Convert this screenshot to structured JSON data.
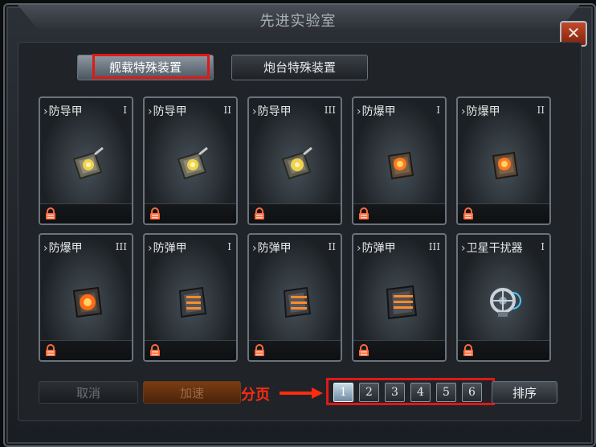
{
  "window": {
    "title": "先进实验室",
    "close_label": "✕"
  },
  "tabs": [
    {
      "label": "舰载特殊装置",
      "active": true
    },
    {
      "label": "炮台特殊装置",
      "active": false
    }
  ],
  "items": [
    {
      "name": "防导甲",
      "tier": "I",
      "icon": "missile-armor-icon"
    },
    {
      "name": "防导甲",
      "tier": "II",
      "icon": "missile-armor-icon"
    },
    {
      "name": "防导甲",
      "tier": "III",
      "icon": "missile-armor-icon"
    },
    {
      "name": "防爆甲",
      "tier": "I",
      "icon": "blast-armor-icon"
    },
    {
      "name": "防爆甲",
      "tier": "II",
      "icon": "blast-armor-icon"
    },
    {
      "name": "防爆甲",
      "tier": "III",
      "icon": "blast-armor-icon"
    },
    {
      "name": "防弹甲",
      "tier": "I",
      "icon": "bullet-armor-icon"
    },
    {
      "name": "防弹甲",
      "tier": "II",
      "icon": "bullet-armor-icon"
    },
    {
      "name": "防弹甲",
      "tier": "III",
      "icon": "bullet-armor-icon"
    },
    {
      "name": "卫星干扰器",
      "tier": "I",
      "icon": "satellite-jammer-icon"
    }
  ],
  "footer": {
    "cancel_label": "取消",
    "speedup_label": "加速",
    "pagination_annotation": "分页",
    "pages": [
      "1",
      "2",
      "3",
      "4",
      "5",
      "6"
    ],
    "active_page": "1",
    "sort_label": "排序"
  },
  "colors": {
    "highlight": "#e01818",
    "annotation": "#ff2b10"
  }
}
